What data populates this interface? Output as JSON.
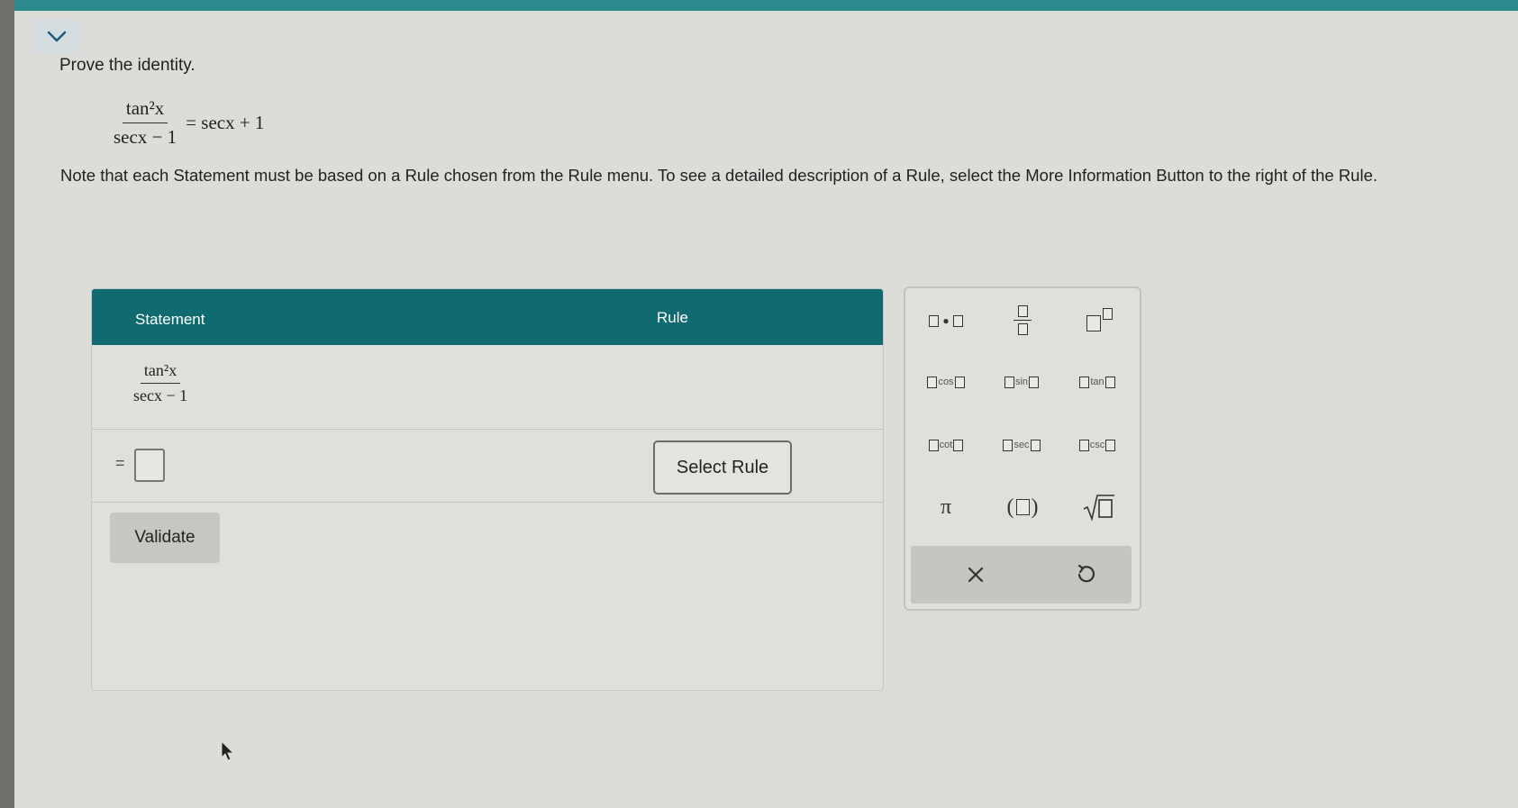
{
  "header": {
    "collapse_icon": "chevron-down-icon",
    "accent_color": "#2a8a8c"
  },
  "problem": {
    "prompt": "Prove the identity.",
    "identity": {
      "numerator": "tan²x",
      "denominator": "secx − 1",
      "rhs": "= secx + 1"
    },
    "note": "Note that each Statement must be based on a Rule chosen from the Rule menu. To see a detailed description of a Rule, select the More Information Button to the right of the Rule."
  },
  "proof_table": {
    "header_color": "#0f6b70",
    "columns": [
      "Statement",
      "Rule"
    ],
    "first_statement": {
      "numerator": "tan²x",
      "denominator": "secx − 1"
    },
    "equals_sign": "=",
    "select_rule_label": "Select Rule",
    "validate_label": "Validate"
  },
  "palette": {
    "buttons": [
      {
        "name": "multiply-template",
        "icon": "dot-product-icon"
      },
      {
        "name": "fraction-template",
        "icon": "fraction-icon"
      },
      {
        "name": "exponent-template",
        "icon": "superscript-icon"
      },
      {
        "name": "cos-template",
        "label": "cos"
      },
      {
        "name": "sin-template",
        "label": "sin"
      },
      {
        "name": "tan-template",
        "label": "tan"
      },
      {
        "name": "cot-template",
        "label": "cot"
      },
      {
        "name": "sec-template",
        "label": "sec"
      },
      {
        "name": "csc-template",
        "label": "csc"
      },
      {
        "name": "pi-symbol",
        "label": "π"
      },
      {
        "name": "parentheses-template",
        "icon": "parentheses-icon"
      },
      {
        "name": "sqrt-template",
        "icon": "square-root-icon"
      }
    ],
    "clear_icon": "close-icon",
    "undo_icon": "undo-icon"
  }
}
